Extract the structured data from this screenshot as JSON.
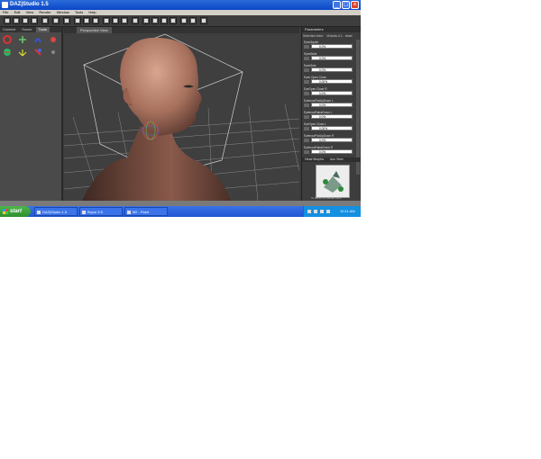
{
  "window": {
    "title": "DAZ|Studio 1.5"
  },
  "menu": [
    "File",
    "Edit",
    "View",
    "Render",
    "Window",
    "Tools",
    "Help"
  ],
  "left_panel": {
    "tabs": [
      "Content",
      "Scene",
      "Tools"
    ],
    "active_tab": "Tools"
  },
  "viewport": {
    "title": "Perspective View"
  },
  "parameters": {
    "title": "Parameters",
    "selection_label": "Selection Item:",
    "selection_value": "Victoria 4.1 - head",
    "params": [
      {
        "label": "EyesSquint",
        "value": "0.0%"
      },
      {
        "label": "EyesWide",
        "value": "0.0%"
      },
      {
        "label": "EyesSide",
        "value": "0.0%"
      },
      {
        "label": "Eyes Open Close",
        "value": "0.00%"
      },
      {
        "label": "EyeOpen Close R",
        "value": "0.0%"
      },
      {
        "label": "EyebrowFlatUpDown L",
        "value": "0.0%"
      },
      {
        "label": "EyebrowRaiseDown L",
        "value": "0.0%"
      },
      {
        "label": "EyeOpen Close L",
        "value": "0.00%"
      },
      {
        "label": "EyebrowFlatUpDown R",
        "value": "0.0%"
      },
      {
        "label": "EyebrowRaiseDown R",
        "value": "0.0%"
      }
    ],
    "footer": "Head Morphs"
  },
  "mini": {
    "title": "Aux View",
    "caption": "To Switch to Mouse Click"
  },
  "taskbar": {
    "start": "start",
    "tasks": [
      {
        "label": "DAZ|Studio 1.5"
      },
      {
        "label": "Bryce 5.5"
      },
      {
        "label": "fit2 - Paint"
      }
    ],
    "clock": "10:11 AM"
  },
  "colors": {
    "titlebar": "#0a46c8",
    "ui_dark": "#3c3c3c",
    "taskbar": "#1f55d2",
    "start": "#2f8f2f"
  }
}
